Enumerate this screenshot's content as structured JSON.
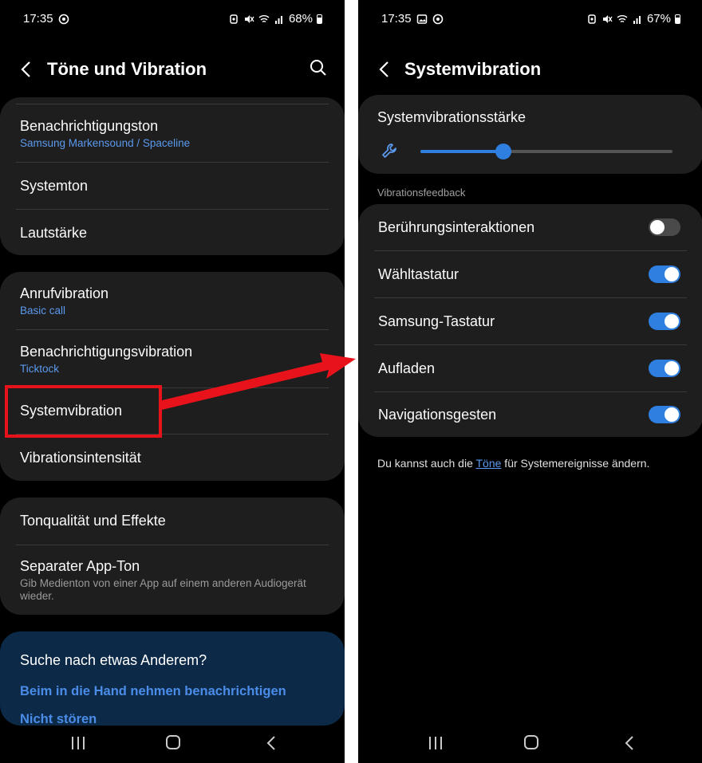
{
  "left": {
    "status": {
      "time": "17:35",
      "battery": "68%"
    },
    "appbar": {
      "title": "Töne und Vibration"
    },
    "group1": [
      {
        "label": "Benachrichtigungston",
        "sub": "Samsung Markensound / Spaceline"
      },
      {
        "label": "Systemton"
      },
      {
        "label": "Lautstärke"
      }
    ],
    "group2": [
      {
        "label": "Anrufvibration",
        "sub": "Basic call"
      },
      {
        "label": "Benachrichtigungsvibration",
        "sub": "Ticktock"
      },
      {
        "label": "Systemvibration"
      },
      {
        "label": "Vibrationsintensität"
      }
    ],
    "group3": [
      {
        "label": "Tonqualität und Effekte"
      },
      {
        "label": "Separater App-Ton",
        "sub": "Gib Medienton von einer App auf einem anderen Audiogerät wieder."
      }
    ],
    "help": {
      "title": "Suche nach etwas Anderem?",
      "links": [
        "Beim in die Hand nehmen benachrichtigen",
        "Nicht stören"
      ]
    }
  },
  "right": {
    "status": {
      "time": "17:35",
      "battery": "67%"
    },
    "appbar": {
      "title": "Systemvibration"
    },
    "strength": {
      "label": "Systemvibrationsstärke",
      "level": 0.33
    },
    "section_label": "Vibrationsfeedback",
    "toggles": [
      {
        "label": "Berührungsinteraktionen",
        "on": false
      },
      {
        "label": "Wähltastatur",
        "on": true
      },
      {
        "label": "Samsung-Tastatur",
        "on": true
      },
      {
        "label": "Aufladen",
        "on": true
      },
      {
        "label": "Navigationsgesten",
        "on": true
      }
    ],
    "footnote": {
      "before": "Du kannst auch die ",
      "link": "Töne",
      "after": " für Systemereignisse ändern."
    }
  },
  "colors": {
    "accent": "#2e7fe0",
    "link": "#5b9aee",
    "highlight": "#e8121a",
    "card": "#1e1e1e",
    "help_card": "#0c2a47"
  },
  "icons": [
    "back-arrow-icon",
    "search-icon",
    "wrench-icon",
    "recent-apps-icon",
    "home-icon",
    "nav-back-icon"
  ]
}
